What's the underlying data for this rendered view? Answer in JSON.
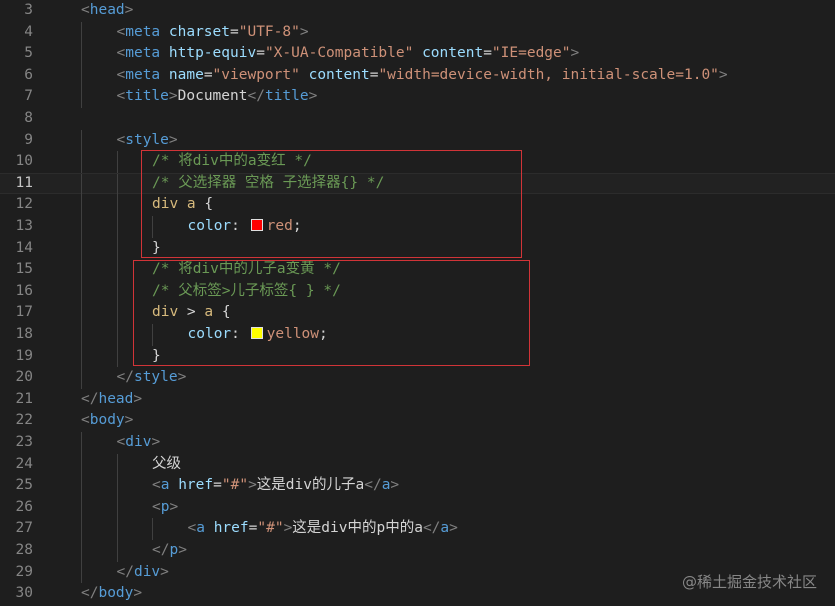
{
  "colors": {
    "background": "#1e1e1e",
    "tag": "#569cd6",
    "punctuation": "#808080",
    "attribute": "#9cdcfe",
    "string": "#ce9178",
    "text": "#d4d4d4",
    "comment": "#6a9955",
    "selector": "#d7ba7d",
    "line_number": "#858585",
    "highlight_box": "#d13438"
  },
  "active_line": 11,
  "lines": [
    {
      "n": "3",
      "indent": 0,
      "tokens": [
        [
          "punct",
          "<"
        ],
        [
          "tag",
          "head"
        ],
        [
          "punct",
          ">"
        ]
      ]
    },
    {
      "n": "4",
      "indent": 1,
      "tokens": [
        [
          "punct",
          "<"
        ],
        [
          "tag",
          "meta"
        ],
        [
          "text",
          " "
        ],
        [
          "attr",
          "charset"
        ],
        [
          "text",
          "="
        ],
        [
          "str",
          "\"UTF-8\""
        ],
        [
          "punct",
          ">"
        ]
      ]
    },
    {
      "n": "5",
      "indent": 1,
      "tokens": [
        [
          "punct",
          "<"
        ],
        [
          "tag",
          "meta"
        ],
        [
          "text",
          " "
        ],
        [
          "attr",
          "http-equiv"
        ],
        [
          "text",
          "="
        ],
        [
          "str",
          "\"X-UA-Compatible\""
        ],
        [
          "text",
          " "
        ],
        [
          "attr",
          "content"
        ],
        [
          "text",
          "="
        ],
        [
          "str",
          "\"IE=edge\""
        ],
        [
          "punct",
          ">"
        ]
      ]
    },
    {
      "n": "6",
      "indent": 1,
      "tokens": [
        [
          "punct",
          "<"
        ],
        [
          "tag",
          "meta"
        ],
        [
          "text",
          " "
        ],
        [
          "attr",
          "name"
        ],
        [
          "text",
          "="
        ],
        [
          "str",
          "\"viewport\""
        ],
        [
          "text",
          " "
        ],
        [
          "attr",
          "content"
        ],
        [
          "text",
          "="
        ],
        [
          "str",
          "\"width=device-width, initial-scale=1.0\""
        ],
        [
          "punct",
          ">"
        ]
      ]
    },
    {
      "n": "7",
      "indent": 1,
      "tokens": [
        [
          "punct",
          "<"
        ],
        [
          "tag",
          "title"
        ],
        [
          "punct",
          ">"
        ],
        [
          "text",
          "Document"
        ],
        [
          "punct",
          "</"
        ],
        [
          "tag",
          "title"
        ],
        [
          "punct",
          ">"
        ]
      ]
    },
    {
      "n": "8",
      "indent": 0,
      "tokens": []
    },
    {
      "n": "9",
      "indent": 1,
      "tokens": [
        [
          "punct",
          "<"
        ],
        [
          "tag",
          "style"
        ],
        [
          "punct",
          ">"
        ]
      ]
    },
    {
      "n": "10",
      "indent": 2,
      "tokens": [
        [
          "comment",
          "/* 将div中的a变红 */"
        ]
      ]
    },
    {
      "n": "11",
      "indent": 2,
      "tokens": [
        [
          "comment",
          "/* 父选择器 空格 子选择器{} */"
        ]
      ]
    },
    {
      "n": "12",
      "indent": 2,
      "tokens": [
        [
          "sel",
          "div a"
        ],
        [
          "text",
          " {"
        ]
      ]
    },
    {
      "n": "13",
      "indent": 3,
      "tokens": [
        [
          "prop",
          "color"
        ],
        [
          "text",
          ": "
        ],
        [
          "swatch",
          "#ff0000"
        ],
        [
          "val",
          "red"
        ],
        [
          "text",
          ";"
        ]
      ]
    },
    {
      "n": "14",
      "indent": 2,
      "tokens": [
        [
          "text",
          "}"
        ]
      ]
    },
    {
      "n": "15",
      "indent": 2,
      "tokens": [
        [
          "comment",
          "/* 将div中的儿子a变黄 */"
        ]
      ]
    },
    {
      "n": "16",
      "indent": 2,
      "tokens": [
        [
          "comment",
          "/* 父标签>儿子标签{ } */"
        ]
      ]
    },
    {
      "n": "17",
      "indent": 2,
      "tokens": [
        [
          "sel",
          "div"
        ],
        [
          "text",
          " > "
        ],
        [
          "sel",
          "a"
        ],
        [
          "text",
          " {"
        ]
      ]
    },
    {
      "n": "18",
      "indent": 3,
      "tokens": [
        [
          "prop",
          "color"
        ],
        [
          "text",
          ": "
        ],
        [
          "swatch",
          "#ffff00"
        ],
        [
          "val",
          "yellow"
        ],
        [
          "text",
          ";"
        ]
      ]
    },
    {
      "n": "19",
      "indent": 2,
      "tokens": [
        [
          "text",
          "}"
        ]
      ]
    },
    {
      "n": "20",
      "indent": 1,
      "tokens": [
        [
          "punct",
          "</"
        ],
        [
          "tag",
          "style"
        ],
        [
          "punct",
          ">"
        ]
      ]
    },
    {
      "n": "21",
      "indent": 0,
      "tokens": [
        [
          "punct",
          "</"
        ],
        [
          "tag",
          "head"
        ],
        [
          "punct",
          ">"
        ]
      ]
    },
    {
      "n": "22",
      "indent": 0,
      "tokens": [
        [
          "punct",
          "<"
        ],
        [
          "tag",
          "body"
        ],
        [
          "punct",
          ">"
        ]
      ]
    },
    {
      "n": "23",
      "indent": 1,
      "tokens": [
        [
          "punct",
          "<"
        ],
        [
          "tag",
          "div"
        ],
        [
          "punct",
          ">"
        ]
      ]
    },
    {
      "n": "24",
      "indent": 2,
      "tokens": [
        [
          "text",
          "父级"
        ]
      ]
    },
    {
      "n": "25",
      "indent": 2,
      "tokens": [
        [
          "punct",
          "<"
        ],
        [
          "tag",
          "a"
        ],
        [
          "text",
          " "
        ],
        [
          "attr",
          "href"
        ],
        [
          "text",
          "="
        ],
        [
          "str",
          "\"#\""
        ],
        [
          "punct",
          ">"
        ],
        [
          "text",
          "这是div的儿子a"
        ],
        [
          "punct",
          "</"
        ],
        [
          "tag",
          "a"
        ],
        [
          "punct",
          ">"
        ]
      ]
    },
    {
      "n": "26",
      "indent": 2,
      "tokens": [
        [
          "punct",
          "<"
        ],
        [
          "tag",
          "p"
        ],
        [
          "punct",
          ">"
        ]
      ]
    },
    {
      "n": "27",
      "indent": 3,
      "tokens": [
        [
          "punct",
          "<"
        ],
        [
          "tag",
          "a"
        ],
        [
          "text",
          " "
        ],
        [
          "attr",
          "href"
        ],
        [
          "text",
          "="
        ],
        [
          "str",
          "\"#\""
        ],
        [
          "punct",
          ">"
        ],
        [
          "text",
          "这是div中的p中的a"
        ],
        [
          "punct",
          "</"
        ],
        [
          "tag",
          "a"
        ],
        [
          "punct",
          ">"
        ]
      ]
    },
    {
      "n": "28",
      "indent": 2,
      "tokens": [
        [
          "punct",
          "</"
        ],
        [
          "tag",
          "p"
        ],
        [
          "punct",
          ">"
        ]
      ]
    },
    {
      "n": "29",
      "indent": 1,
      "tokens": [
        [
          "punct",
          "</"
        ],
        [
          "tag",
          "div"
        ],
        [
          "punct",
          ">"
        ]
      ]
    },
    {
      "n": "30",
      "indent": 0,
      "tokens": [
        [
          "punct",
          "</"
        ],
        [
          "tag",
          "body"
        ],
        [
          "punct",
          ">"
        ]
      ]
    }
  ],
  "watermark": "@稀土掘金技术社区"
}
